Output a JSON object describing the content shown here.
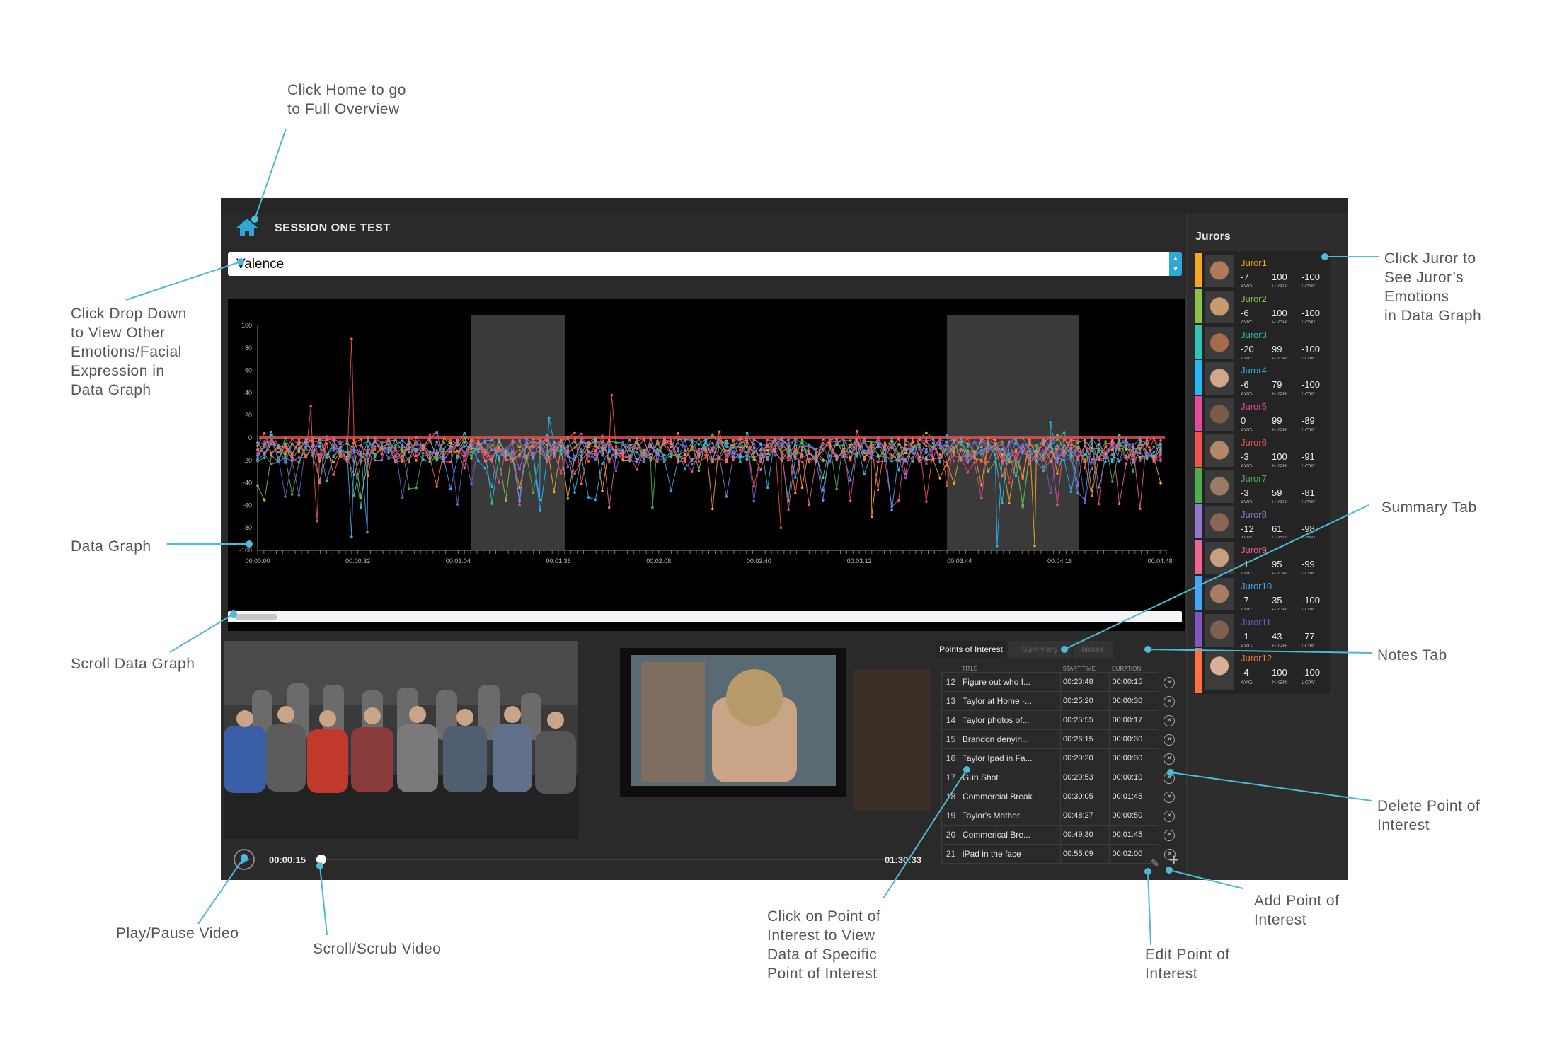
{
  "app": {
    "session_title": "SESSION ONE TEST",
    "emotion_dropdown_value": "Valence",
    "home_icon": "home-icon"
  },
  "graph": {
    "type": "line",
    "y_ticks": [
      "100",
      "80",
      "60",
      "40",
      "20",
      "0",
      "-20",
      "-40",
      "-60",
      "-80",
      "-100"
    ],
    "x_ticks": [
      "00:00:00",
      "00:00:32",
      "00:01:04",
      "00:01:36",
      "00:02:08",
      "00:02:40",
      "00:03:12",
      "00:03:44",
      "00:04:16",
      "00:04:48"
    ],
    "ylim": [
      -100,
      100
    ],
    "xlim_seconds": [
      0,
      290
    ],
    "highlight_ranges_seconds": [
      [
        68,
        98
      ],
      [
        220,
        262
      ]
    ],
    "series_colors": [
      "#f5a623",
      "#8bc34a",
      "#2ec4b6",
      "#29b6f6",
      "#e64a99",
      "#ef5350",
      "#4caf50",
      "#9575cd",
      "#f06292",
      "#42a5f5",
      "#7e57c2",
      "#ff7043"
    ],
    "spikes": [
      {
        "t": 30,
        "v": 88,
        "color": "#ef5350"
      },
      {
        "t": 17,
        "v": 28,
        "color": "#ef5350"
      },
      {
        "t": 113,
        "v": 38,
        "color": "#ef5350"
      },
      {
        "t": 93,
        "v": 18,
        "color": "#29b6f6"
      },
      {
        "t": 253,
        "v": 14,
        "color": "#29b6f6"
      },
      {
        "t": 30,
        "v": -88,
        "color": "#42a5f5"
      },
      {
        "t": 35,
        "v": -84,
        "color": "#42a5f5"
      },
      {
        "t": 236,
        "v": -96,
        "color": "#29b6f6"
      },
      {
        "t": 248,
        "v": -96,
        "color": "#f5a623"
      },
      {
        "t": 196,
        "v": -70,
        "color": "#f5a623"
      },
      {
        "t": 167,
        "v": -80,
        "color": "#ef5350"
      },
      {
        "t": 19,
        "v": -74,
        "color": "#ef5350"
      },
      {
        "t": 126,
        "v": -62,
        "color": "#4caf50"
      },
      {
        "t": 90,
        "v": -55,
        "color": "#42a5f5"
      }
    ]
  },
  "video": {
    "current_time": "00:00:15",
    "total_time": "01:30:33",
    "progress": 0.003
  },
  "tabs": {
    "points_of_interest": "Points of Interest",
    "summary": "Summary",
    "notes": "Notes"
  },
  "poi_table": {
    "headers": {
      "num": "",
      "title": "TITLE",
      "start": "START TIME",
      "duration": "DURATION"
    },
    "rows": [
      {
        "num": "12",
        "title": "Figure out who I...",
        "start": "00:23:48",
        "duration": "00:00:15"
      },
      {
        "num": "13",
        "title": "Taylor at Home -...",
        "start": "00:25:20",
        "duration": "00:00:30"
      },
      {
        "num": "14",
        "title": "Taylor photos of...",
        "start": "00:25:55",
        "duration": "00:00:17"
      },
      {
        "num": "15",
        "title": "Brandon denyin...",
        "start": "00:26:15",
        "duration": "00:00:30"
      },
      {
        "num": "16",
        "title": "Taylor Ipad in Fa...",
        "start": "00:29:20",
        "duration": "00:00:30"
      },
      {
        "num": "17",
        "title": "Gun Shot",
        "start": "00:29:53",
        "duration": "00:00:10"
      },
      {
        "num": "18",
        "title": "Commercial Break",
        "start": "00:30:05",
        "duration": "00:01:45"
      },
      {
        "num": "19",
        "title": "Taylor's Mother...",
        "start": "00:48:27",
        "duration": "00:00:50"
      },
      {
        "num": "20",
        "title": "Commerical Bre...",
        "start": "00:49:30",
        "duration": "00:01:45"
      },
      {
        "num": "21",
        "title": "iPad in the face",
        "start": "00:55:09",
        "duration": "00:02:00"
      }
    ]
  },
  "jurors": {
    "title": "Jurors",
    "labels": {
      "avg": "AVG",
      "high": "HIGH",
      "low": "LOW"
    },
    "items": [
      {
        "name": "Juror1",
        "avg": "-7",
        "high": "100",
        "low": "-100",
        "color": "#f5a623"
      },
      {
        "name": "Juror2",
        "avg": "-6",
        "high": "100",
        "low": "-100",
        "color": "#8bc34a"
      },
      {
        "name": "Juror3",
        "avg": "-20",
        "high": "99",
        "low": "-100",
        "color": "#2ec4b6"
      },
      {
        "name": "Juror4",
        "avg": "-6",
        "high": "79",
        "low": "-100",
        "color": "#29b6f6"
      },
      {
        "name": "Juror5",
        "avg": "0",
        "high": "99",
        "low": "-89",
        "color": "#e64a99"
      },
      {
        "name": "Juror6",
        "avg": "-3",
        "high": "100",
        "low": "-91",
        "color": "#ef5350"
      },
      {
        "name": "Juror7",
        "avg": "-3",
        "high": "59",
        "low": "-81",
        "color": "#4caf50"
      },
      {
        "name": "Juror8",
        "avg": "-12",
        "high": "61",
        "low": "-98",
        "color": "#9575cd"
      },
      {
        "name": "Juror9",
        "avg": "-1",
        "high": "95",
        "low": "-99",
        "color": "#f06292"
      },
      {
        "name": "Juror10",
        "avg": "-7",
        "high": "35",
        "low": "-100",
        "color": "#42a5f5"
      },
      {
        "name": "Juror11",
        "avg": "-1",
        "high": "43",
        "low": "-77",
        "color": "#7e57c2"
      },
      {
        "name": "Juror12",
        "avg": "-4",
        "high": "100",
        "low": "-100",
        "color": "#ff7043"
      }
    ]
  },
  "annotations": {
    "home": "Click Home to go\nto Full Overview",
    "dropdown": "Click Drop Down\nto View Other\nEmotions/Facial\nExpression in\nData Graph",
    "data_graph": "Data Graph",
    "scroll_graph": "Scroll Data Graph",
    "play_pause": "Play/Pause Video",
    "scrub": "Scroll/Scrub Video",
    "click_poi": "Click on Point of\nInterest to View\nData of Specific\nPoint of Interest",
    "edit_poi": "Edit Point of\nInterest",
    "add_poi": "Add Point of\nInterest",
    "delete_poi": "Delete Point of\nInterest",
    "notes_tab": "Notes Tab",
    "summary_tab": "Summary Tab",
    "click_juror": "Click Juror to\nSee Juror’s\nEmotions\nin Data Graph"
  }
}
